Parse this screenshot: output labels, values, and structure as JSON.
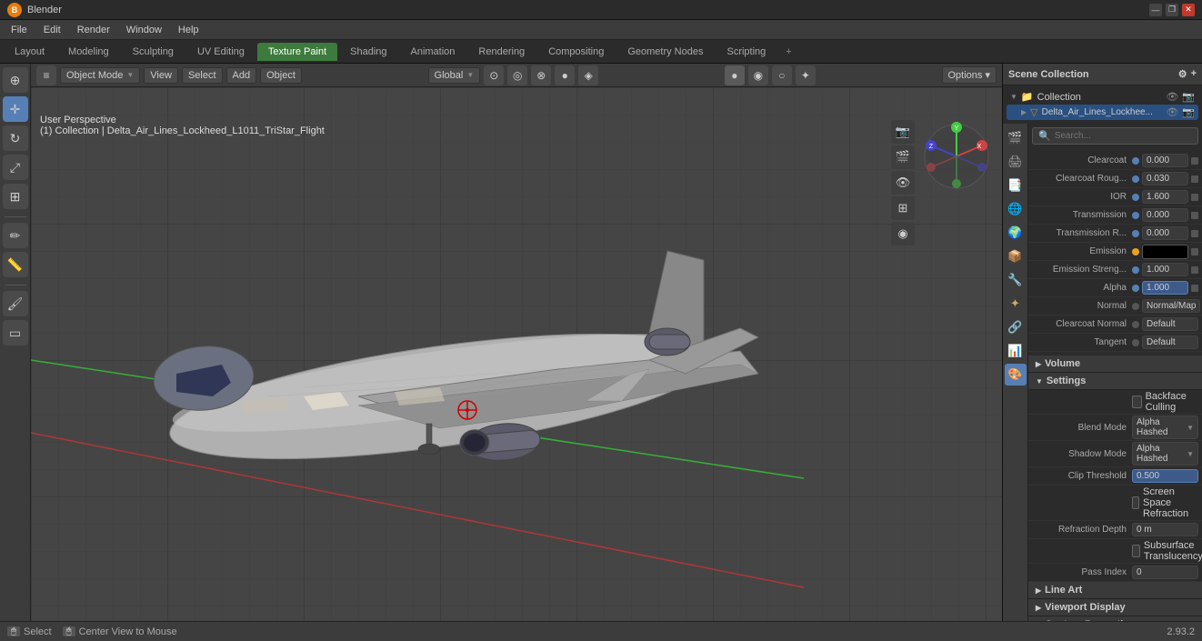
{
  "titlebar": {
    "title": "Blender",
    "app_name": "Blender",
    "win_controls": [
      "—",
      "❐",
      "✕"
    ]
  },
  "menubar": {
    "items": [
      "File",
      "Edit",
      "Render",
      "Window",
      "Help"
    ]
  },
  "workspace_tabs": {
    "tabs": [
      "Layout",
      "Modeling",
      "Sculpting",
      "UV Editing",
      "Texture Paint",
      "Shading",
      "Animation",
      "Rendering",
      "Compositing",
      "Geometry Nodes",
      "Scripting"
    ],
    "active": "Texture Paint",
    "plus_label": "+"
  },
  "viewport_header": {
    "mode_dropdown": "Object Mode",
    "view_label": "View",
    "select_label": "Select",
    "add_label": "Add",
    "object_label": "Object",
    "transform_dropdown": "Global",
    "options_label": "Options"
  },
  "viewport_info": {
    "line1": "User Perspective",
    "line2": "(1) Collection | Delta_Air_Lines_Lockheed_L1011_TriStar_Flight"
  },
  "statusbar": {
    "select_label": "Select",
    "center_label": "Center View to Mouse",
    "version": "2.93.2"
  },
  "scene_collection": {
    "title": "Scene Collection",
    "items": [
      {
        "name": "Collection",
        "level": 0,
        "expanded": true
      },
      {
        "name": "Delta_Air_Lines_Lockhee...",
        "level": 1,
        "expanded": false
      }
    ]
  },
  "properties": {
    "search_placeholder": "Search...",
    "sections": [
      {
        "title": "Volume",
        "collapsed": true,
        "rows": []
      },
      {
        "title": "Settings",
        "collapsed": false,
        "rows": [
          {
            "label": "",
            "type": "checkbox",
            "key": "backface_culling",
            "checkbox_label": "Backface Culling",
            "value": false
          },
          {
            "label": "Blend Mode",
            "type": "select",
            "value": "Alpha Hashed"
          },
          {
            "label": "Shadow Mode",
            "type": "select",
            "value": "Alpha Hashed"
          },
          {
            "label": "Clip Threshold",
            "type": "number_blue",
            "value": "0.500"
          },
          {
            "label": "",
            "type": "checkbox",
            "key": "screen_space_refraction",
            "checkbox_label": "Screen Space Refraction",
            "value": false
          },
          {
            "label": "Refraction Depth",
            "type": "number",
            "value": "0 m"
          },
          {
            "label": "",
            "type": "checkbox",
            "key": "subsurface_translucency",
            "checkbox_label": "Subsurface Translucency",
            "value": false
          },
          {
            "label": "Pass Index",
            "type": "number",
            "value": "0"
          }
        ]
      },
      {
        "title": "Line Art",
        "collapsed": true,
        "rows": []
      },
      {
        "title": "Viewport Display",
        "collapsed": true,
        "rows": []
      },
      {
        "title": "Custom Properties",
        "collapsed": true,
        "rows": []
      }
    ],
    "material_rows": [
      {
        "label": "Clearcoat",
        "dot": "blue",
        "value": "0.000"
      },
      {
        "label": "Clearcoat Roug...",
        "dot": "blue",
        "value": "0.030"
      },
      {
        "label": "IOR",
        "dot": "blue",
        "value": "1.600"
      },
      {
        "label": "Transmission",
        "dot": "blue",
        "value": "0.000"
      },
      {
        "label": "Transmission R...",
        "dot": "blue",
        "value": "0.000"
      },
      {
        "label": "Emission",
        "dot": "yellow",
        "value": "",
        "type": "black"
      },
      {
        "label": "Emission Streng...",
        "dot": "blue",
        "value": "1.000"
      },
      {
        "label": "Alpha",
        "dot": "blue",
        "value": "1.000",
        "highlight": true
      },
      {
        "label": "Normal",
        "dot": "dark",
        "value": "Normal/Map"
      },
      {
        "label": "Clearcoat Normal",
        "dot": "dark",
        "value": "Default"
      },
      {
        "label": "Tangent",
        "dot": "dark",
        "value": "Default"
      }
    ],
    "props_icons": [
      "🎬",
      "🎥",
      "⚙",
      "🌍",
      "📦",
      "🔧",
      "✦",
      "🔗",
      "📊",
      "🎨"
    ]
  }
}
